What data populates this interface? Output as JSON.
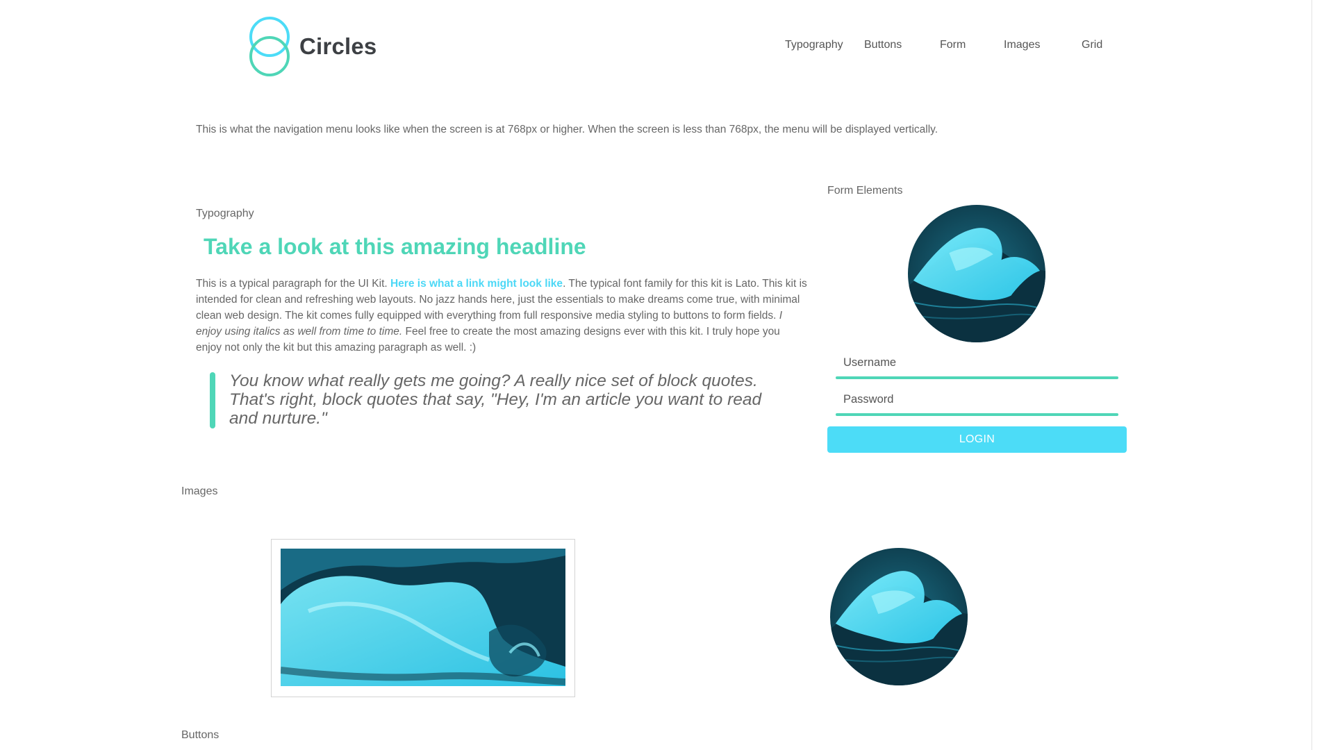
{
  "brand": {
    "name": "Circles",
    "accent": "#4fd6b7",
    "primary": "#4cdcf7"
  },
  "nav": {
    "items": [
      {
        "label": "Typography"
      },
      {
        "label": "Buttons"
      },
      {
        "label": "Form"
      },
      {
        "label": "Images"
      },
      {
        "label": "Grid"
      }
    ]
  },
  "intro_text": "This is what the navigation menu looks like when the screen is at 768px or higher. When the screen is less than 768px, the menu will be displayed vertically.",
  "typography": {
    "label": "Typography",
    "headline": "Take a look at this amazing headline",
    "para_1": "This is a typical paragraph for the UI Kit. ",
    "link": "Here is what a link might look like",
    "para_2": ". The typical font family for this kit is Lato. This kit is intended for clean and refreshing web layouts. No jazz hands here, just the essentials to make dreams come true, with minimal clean web design. The kit comes fully equipped with everything from full responsive media styling to buttons to form fields. ",
    "italic": "I enjoy using italics as well from time to time.",
    "para_3": " Feel free to create the most amazing designs ever with this kit. I truly hope you enjoy not only the kit but this amazing paragraph as well. :)",
    "blockquote": "You know what really gets me going? A really nice set of block quotes. That's right, block quotes that say, \"Hey, I'm an article you want to read and nurture.\""
  },
  "form": {
    "label": "Form Elements",
    "username_placeholder": "Username",
    "password_placeholder": "Password",
    "login_label": "LOGIN"
  },
  "images": {
    "label": "Images"
  },
  "buttons": {
    "label": "Buttons"
  }
}
